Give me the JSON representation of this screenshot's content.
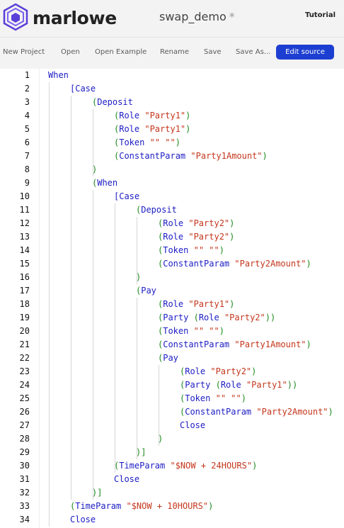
{
  "app": {
    "brand": "marlowe",
    "project_title": "swap_demo",
    "dirty_marker": "*",
    "tutorial_label": "Tutorial"
  },
  "toolbar": {
    "new_project": "New Project",
    "open": "Open",
    "open_example": "Open Example",
    "rename": "Rename",
    "save": "Save",
    "save_as": "Save As...",
    "edit_source": "Edit source"
  },
  "code_lines": [
    [
      {
        "t": "When",
        "c": "kw"
      }
    ],
    [
      {
        "t": "[Case",
        "c": "kw"
      }
    ],
    [
      {
        "t": "(",
        "c": "paren"
      },
      {
        "t": "Deposit",
        "c": "kw"
      }
    ],
    [
      {
        "t": "(",
        "c": "paren"
      },
      {
        "t": "Role ",
        "c": "kw"
      },
      {
        "t": "\"Party1\"",
        "c": "str"
      },
      {
        "t": ")",
        "c": "paren"
      }
    ],
    [
      {
        "t": "(",
        "c": "paren"
      },
      {
        "t": "Role ",
        "c": "kw"
      },
      {
        "t": "\"Party1\"",
        "c": "str"
      },
      {
        "t": ")",
        "c": "paren"
      }
    ],
    [
      {
        "t": "(",
        "c": "paren"
      },
      {
        "t": "Token ",
        "c": "kw"
      },
      {
        "t": "\"\" \"\"",
        "c": "str"
      },
      {
        "t": ")",
        "c": "paren"
      }
    ],
    [
      {
        "t": "(",
        "c": "paren"
      },
      {
        "t": "ConstantParam ",
        "c": "kw"
      },
      {
        "t": "\"Party1Amount\"",
        "c": "str"
      },
      {
        "t": ")",
        "c": "paren"
      }
    ],
    [
      {
        "t": ")",
        "c": "paren"
      }
    ],
    [
      {
        "t": "(",
        "c": "paren"
      },
      {
        "t": "When",
        "c": "kw"
      }
    ],
    [
      {
        "t": "[Case",
        "c": "kw"
      }
    ],
    [
      {
        "t": "(",
        "c": "paren"
      },
      {
        "t": "Deposit",
        "c": "kw"
      }
    ],
    [
      {
        "t": "(",
        "c": "paren"
      },
      {
        "t": "Role ",
        "c": "kw"
      },
      {
        "t": "\"Party2\"",
        "c": "str"
      },
      {
        "t": ")",
        "c": "paren"
      }
    ],
    [
      {
        "t": "(",
        "c": "paren"
      },
      {
        "t": "Role ",
        "c": "kw"
      },
      {
        "t": "\"Party2\"",
        "c": "str"
      },
      {
        "t": ")",
        "c": "paren"
      }
    ],
    [
      {
        "t": "(",
        "c": "paren"
      },
      {
        "t": "Token ",
        "c": "kw"
      },
      {
        "t": "\"\" \"\"",
        "c": "str"
      },
      {
        "t": ")",
        "c": "paren"
      }
    ],
    [
      {
        "t": "(",
        "c": "paren"
      },
      {
        "t": "ConstantParam ",
        "c": "kw"
      },
      {
        "t": "\"Party2Amount\"",
        "c": "str"
      },
      {
        "t": ")",
        "c": "paren"
      }
    ],
    [
      {
        "t": ")",
        "c": "paren"
      }
    ],
    [
      {
        "t": "(",
        "c": "paren"
      },
      {
        "t": "Pay",
        "c": "kw"
      }
    ],
    [
      {
        "t": "(",
        "c": "paren"
      },
      {
        "t": "Role ",
        "c": "kw"
      },
      {
        "t": "\"Party1\"",
        "c": "str"
      },
      {
        "t": ")",
        "c": "paren"
      }
    ],
    [
      {
        "t": "(",
        "c": "paren"
      },
      {
        "t": "Party ",
        "c": "kw"
      },
      {
        "t": "(",
        "c": "paren"
      },
      {
        "t": "Role ",
        "c": "kw"
      },
      {
        "t": "\"Party2\"",
        "c": "str"
      },
      {
        "t": "))",
        "c": "paren"
      }
    ],
    [
      {
        "t": "(",
        "c": "paren"
      },
      {
        "t": "Token ",
        "c": "kw"
      },
      {
        "t": "\"\" \"\"",
        "c": "str"
      },
      {
        "t": ")",
        "c": "paren"
      }
    ],
    [
      {
        "t": "(",
        "c": "paren"
      },
      {
        "t": "ConstantParam ",
        "c": "kw"
      },
      {
        "t": "\"Party1Amount\"",
        "c": "str"
      },
      {
        "t": ")",
        "c": "paren"
      }
    ],
    [
      {
        "t": "(",
        "c": "paren"
      },
      {
        "t": "Pay",
        "c": "kw"
      }
    ],
    [
      {
        "t": "(",
        "c": "paren"
      },
      {
        "t": "Role ",
        "c": "kw"
      },
      {
        "t": "\"Party2\"",
        "c": "str"
      },
      {
        "t": ")",
        "c": "paren"
      }
    ],
    [
      {
        "t": "(",
        "c": "paren"
      },
      {
        "t": "Party ",
        "c": "kw"
      },
      {
        "t": "(",
        "c": "paren"
      },
      {
        "t": "Role ",
        "c": "kw"
      },
      {
        "t": "\"Party1\"",
        "c": "str"
      },
      {
        "t": "))",
        "c": "paren"
      }
    ],
    [
      {
        "t": "(",
        "c": "paren"
      },
      {
        "t": "Token ",
        "c": "kw"
      },
      {
        "t": "\"\" \"\"",
        "c": "str"
      },
      {
        "t": ")",
        "c": "paren"
      }
    ],
    [
      {
        "t": "(",
        "c": "paren"
      },
      {
        "t": "ConstantParam ",
        "c": "kw"
      },
      {
        "t": "\"Party2Amount\"",
        "c": "str"
      },
      {
        "t": ")",
        "c": "paren"
      }
    ],
    [
      {
        "t": "Close",
        "c": "kw"
      }
    ],
    [
      {
        "t": ")",
        "c": "paren"
      }
    ],
    [
      {
        "t": ")]",
        "c": "paren"
      }
    ],
    [
      {
        "t": "(",
        "c": "paren"
      },
      {
        "t": "TimeParam ",
        "c": "kw"
      },
      {
        "t": "\"$NOW + 24HOURS\"",
        "c": "str"
      },
      {
        "t": ")",
        "c": "paren"
      }
    ],
    [
      {
        "t": "Close",
        "c": "kw"
      }
    ],
    [
      {
        "t": ")]",
        "c": "paren"
      }
    ],
    [
      {
        "t": "(",
        "c": "paren"
      },
      {
        "t": "TimeParam ",
        "c": "kw"
      },
      {
        "t": "\"$NOW + 10HOURS\"",
        "c": "str"
      },
      {
        "t": ")",
        "c": "paren"
      }
    ],
    [
      {
        "t": "Close",
        "c": "kw"
      }
    ]
  ]
}
